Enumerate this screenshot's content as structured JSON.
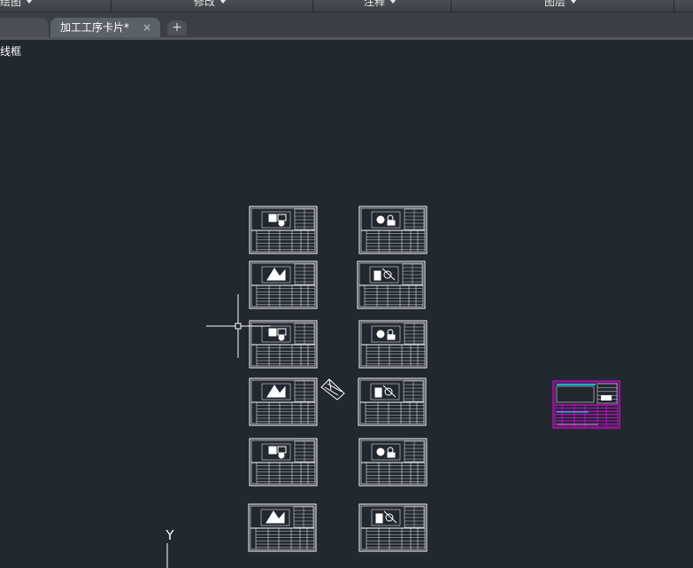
{
  "ribbon": {
    "panels": [
      {
        "label": "绘图"
      },
      {
        "label": "修改"
      },
      {
        "label": "注释"
      },
      {
        "label": "图层"
      }
    ]
  },
  "tabs": {
    "drawing_tab": "加工工序卡片*",
    "close_glyph": "×",
    "add_glyph": "+"
  },
  "viewport": {
    "label": "线框",
    "ucs_axis": "Y"
  },
  "drawing": {
    "sheet_color": "#ffffff",
    "highlight_color": "#ff00ff",
    "highlight_accent": "#00e5ff",
    "sheet_count": 12
  },
  "colors": {
    "background": "#212830",
    "ribbon": "#3b4046",
    "tab_active": "#5b6168"
  }
}
